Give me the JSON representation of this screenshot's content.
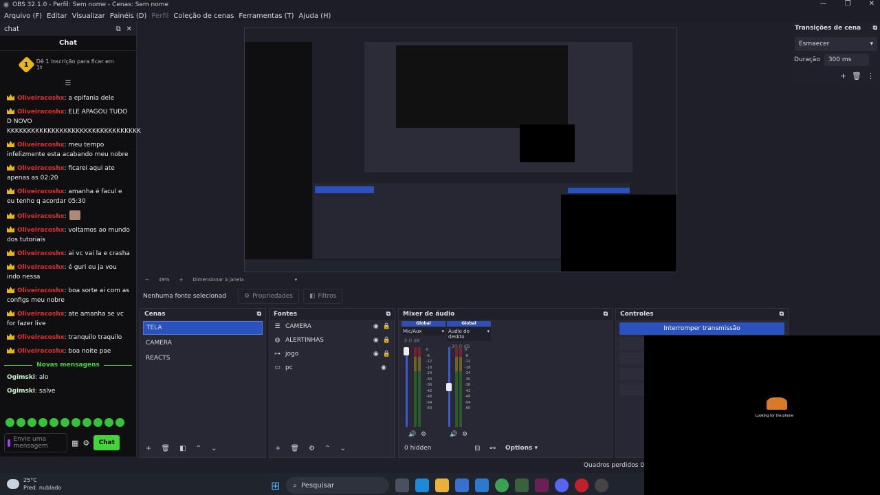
{
  "window": {
    "title": "OBS 32.1.0 - Perfil: Sem nome - Cenas: Sem nome",
    "minimize": "—",
    "maximize": "❐",
    "close": "✕"
  },
  "menu": {
    "items": [
      "Arquivo (F)",
      "Editar",
      "Visualizar",
      "Painéis (D)",
      "Perfil",
      "Coleção de cenas",
      "Ferramentas (T)",
      "Ajuda (H)"
    ]
  },
  "chat": {
    "dock_title": "chat",
    "header": "Chat",
    "sub_number": "1",
    "sub_text": "Dê 1 inscrição para ficar em 1º",
    "messages": [
      {
        "user": "Oliveiracoshx",
        "text": ": a epifania dele"
      },
      {
        "user": "Oliveiracoshx",
        "text": ": ELE APAGOU TUDO D NOVO KKKKKKKKKKKKKKKKKKKKKKKKKKKKKKKKKKKKKKKKK"
      },
      {
        "user": "Oliveiracoshx",
        "text": ": meu tempo infelizmente esta acabando meu nobre"
      },
      {
        "user": "Oliveiracoshx",
        "text": ": ficarei aqui ate apenas as 02:20"
      },
      {
        "user": "Oliveiracoshx",
        "text": ": amanha é facul e eu tenho q acordar 05:30"
      },
      {
        "user": "Oliveiracoshx",
        "text": ":"
      },
      {
        "user": "Oliveiracoshx",
        "text": ": voltamos ao mundo dos tutoriais"
      },
      {
        "user": "Oliveiracoshx",
        "text": ": ai vc vai la e crasha"
      },
      {
        "user": "Oliveiracoshx",
        "text": ": é guri eu ja vou indo nessa"
      },
      {
        "user": "Oliveiracoshx",
        "text": ": boa sorte ai com as configs meu nobre"
      },
      {
        "user": "Oliveiracoshx",
        "text": ": ate amanha se vc for fazer live"
      },
      {
        "user": "Oliveiracoshx",
        "text": ": tranquilo traquilo"
      },
      {
        "user": "Oliveiracoshx",
        "text": ": boa noite pae"
      }
    ],
    "new_messages": "Novas mensagens",
    "green_messages": [
      {
        "user": "Ogimski",
        "text": ": alo"
      },
      {
        "user": "Ogimski",
        "text": ": salve"
      }
    ],
    "input_placeholder": "Envie uma mensagem",
    "send_label": "Chat"
  },
  "zoombar": {
    "minus": "−",
    "zoom": "49%",
    "plus": "+",
    "mode": "Dimensionar à janela"
  },
  "sourcebar": {
    "no_source": "Nenhuma fonte selecionad",
    "properties": "Propriedades",
    "filters": "Filtros"
  },
  "scenes": {
    "title": "Cenas",
    "items": [
      "TELA",
      "CAMERA",
      "REACTS"
    ]
  },
  "sources": {
    "title": "Fontes",
    "items": [
      "CAMERA",
      "ALERTINHAS",
      "jogo",
      "pc"
    ]
  },
  "mixer": {
    "title": "Mixer de áudio",
    "channels": [
      {
        "tag": "Global",
        "name": "Mic/Aux",
        "db": "0.0 dB",
        "fader": 1.0
      },
      {
        "tag": "Global",
        "name": "Áudio do deskto",
        "db": "-30.0 dB",
        "fader": 0.5
      }
    ],
    "scale": [
      "0",
      "-6",
      "-12",
      "-18",
      "-24",
      "-30",
      "-36",
      "-42",
      "-48",
      "-54",
      "-60"
    ],
    "hidden": "0 hidden",
    "options": "Options"
  },
  "controls": {
    "title": "Controles",
    "primary": "Interromper transmissão"
  },
  "transitions": {
    "title": "Transições de cena",
    "selected": "Esmaecer",
    "duration_label": "Duração",
    "duration": "300 ms"
  },
  "status": {
    "dropped": "Quadros perdidos 0"
  },
  "cam_text": "Looking for the phone",
  "taskbar": {
    "temp": "25°C",
    "weather": "Pred. nublado",
    "search": "Pesquisar"
  }
}
